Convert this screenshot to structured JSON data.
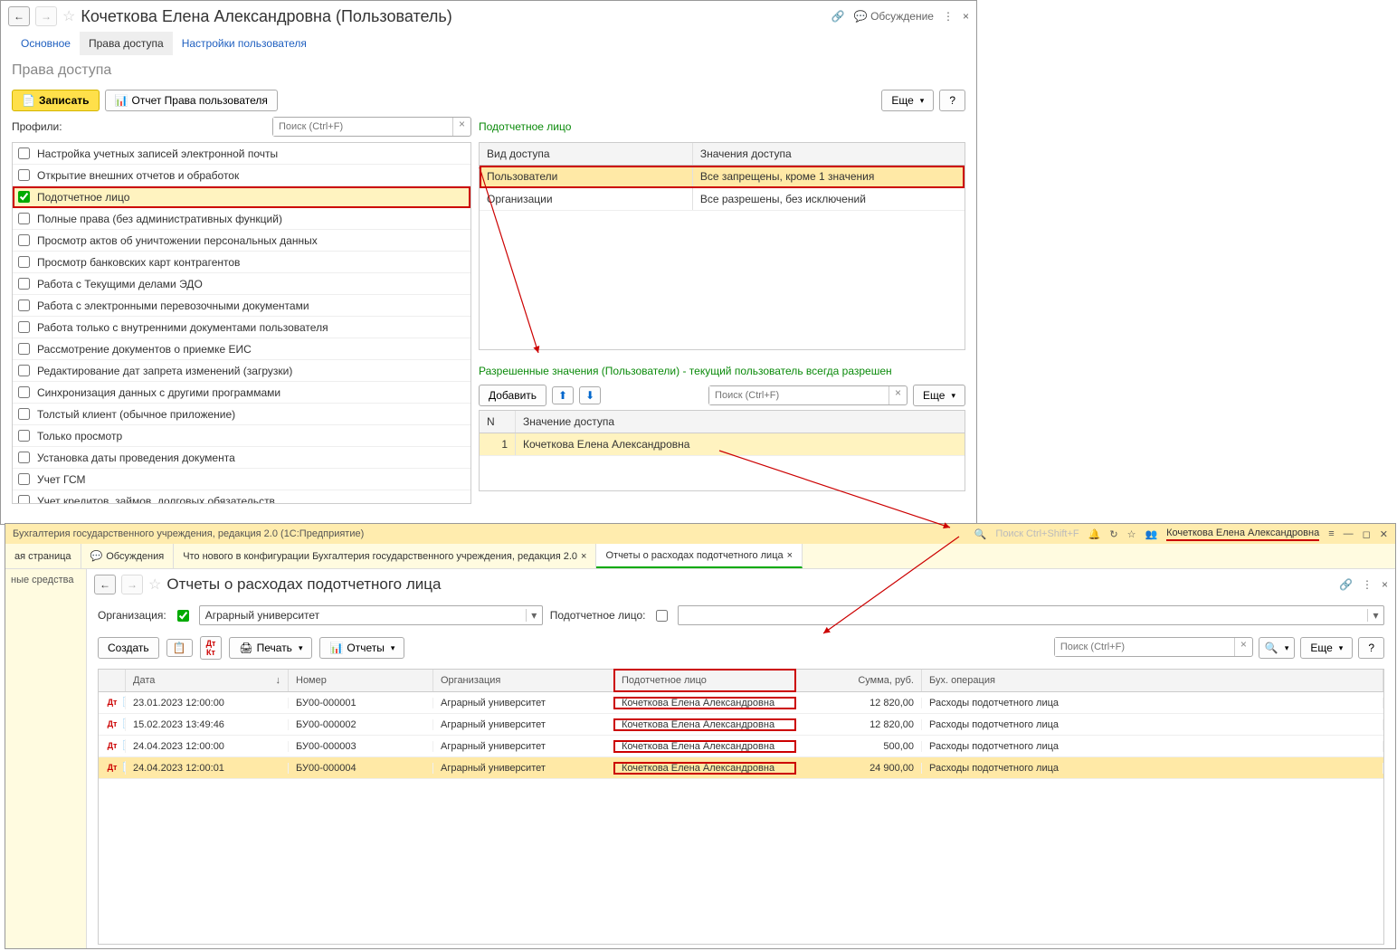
{
  "win1": {
    "title": "Кочеткова Елена Александровна (Пользователь)",
    "discuss": "Обсуждение",
    "tabs": {
      "main": "Основное",
      "access": "Права доступа",
      "settings": "Настройки пользователя"
    },
    "subtitle": "Права доступа",
    "btn_write": "Записать",
    "btn_report": "Отчет Права пользователя",
    "btn_more": "Еще",
    "profiles_label": "Профили:",
    "search_ph": "Поиск (Ctrl+F)",
    "profiles": [
      "Настройка учетных записей электронной почты",
      "Открытие внешних отчетов и обработок",
      "Подотчетное лицо",
      "Полные права (без административных функций)",
      "Просмотр актов об уничтожении персональных данных",
      "Просмотр банковских карт контрагентов",
      "Работа с Текущими делами ЭДО",
      "Работа с электронными перевозочными документами",
      "Работа только с внутренними документами пользователя",
      "Рассмотрение документов о приемке ЕИС",
      "Редактирование дат запрета изменений (загрузки)",
      "Синхронизация данных с другими программами",
      "Толстый клиент (обычное приложение)",
      "Только просмотр",
      "Установка даты проведения документа",
      "Учет ГСМ",
      "Учет кредитов, займов, долговых обязательств"
    ],
    "accountable_label": "Подотчетное лицо",
    "th_access_type": "Вид доступа",
    "th_access_value": "Значения доступа",
    "access_rows": [
      {
        "type": "Пользователи",
        "value": "Все запрещены, кроме 1 значения"
      },
      {
        "type": "Организации",
        "value": "Все разрешены, без исключений"
      }
    ],
    "allowed_label": "Разрешенные значения (Пользователи) - текущий пользователь всегда разрешен",
    "btn_add": "Добавить",
    "th_n": "N",
    "th_access_val": "Значение доступа",
    "allowed_rows": [
      {
        "n": "1",
        "val": "Кочеткова Елена Александровна"
      }
    ]
  },
  "win2": {
    "app_title": "Бухгалтерия государственного учреждения, редакция 2.0  (1С:Предприятие)",
    "global_search_ph": "Поиск Ctrl+Shift+F",
    "user": "Кочеткова Елена Александровна",
    "tabs": {
      "home": "ая страница",
      "discuss": "Обсуждения",
      "news": "Что нового в конфигурации Бухгалтерия государственного учреждения, редакция 2.0",
      "reports": "Отчеты о расходах подотчетного лица"
    },
    "sidebar": "ные средства",
    "page_title": "Отчеты о расходах подотчетного лица",
    "org_label": "Организация:",
    "org_value": "Аграрный университет",
    "person_label": "Подотчетное лицо:",
    "btn_create": "Создать",
    "btn_print": "Печать",
    "btn_reports": "Отчеты",
    "btn_more": "Еще",
    "search_ph": "Поиск (Ctrl+F)",
    "grid_headers": {
      "date": "Дата",
      "num": "Номер",
      "org": "Организация",
      "person": "Подотчетное лицо",
      "sum": "Сумма, руб.",
      "op": "Бух. операция"
    },
    "rows": [
      {
        "date": "23.01.2023 12:00:00",
        "num": "БУ00-000001",
        "org": "Аграрный университет",
        "person": "Кочеткова Елена Александровна",
        "sum": "12 820,00",
        "op": "Расходы подотчетного лица"
      },
      {
        "date": "15.02.2023 13:49:46",
        "num": "БУ00-000002",
        "org": "Аграрный университет",
        "person": "Кочеткова Елена Александровна",
        "sum": "12 820,00",
        "op": "Расходы подотчетного лица"
      },
      {
        "date": "24.04.2023 12:00:00",
        "num": "БУ00-000003",
        "org": "Аграрный университет",
        "person": "Кочеткова Елена Александровна",
        "sum": "500,00",
        "op": "Расходы подотчетного лица"
      },
      {
        "date": "24.04.2023 12:00:01",
        "num": "БУ00-000004",
        "org": "Аграрный университет",
        "person": "Кочеткова Елена Александровна",
        "sum": "24 900,00",
        "op": "Расходы подотчетного лица"
      }
    ]
  }
}
